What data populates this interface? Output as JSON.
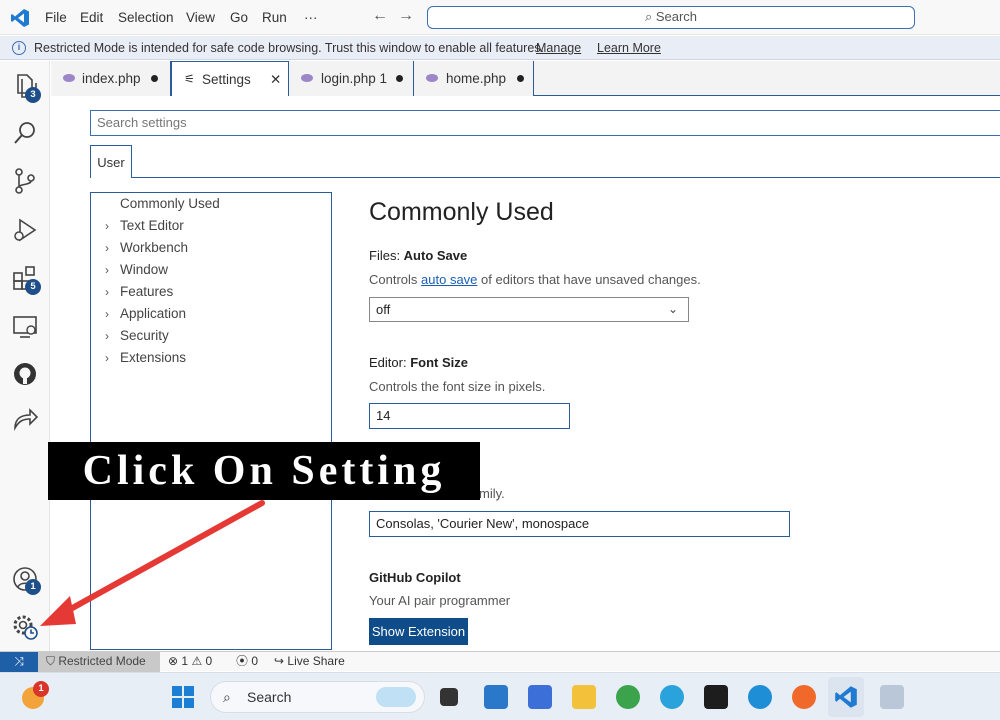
{
  "titlebar": {
    "menus": [
      "File",
      "Edit",
      "Selection",
      "View",
      "Go",
      "Run",
      "···"
    ],
    "search_label": "Search"
  },
  "banner": {
    "message": "Restricted Mode is intended for safe code browsing. Trust this window to enable all features.",
    "manage": "Manage",
    "learn_more": "Learn More"
  },
  "activity_bar": {
    "explorer_badge": "3",
    "extensions_badge": "5",
    "accounts_badge": "1"
  },
  "tabs": [
    {
      "label": "index.php"
    },
    {
      "label": "Settings"
    },
    {
      "label": "login.php 1"
    },
    {
      "label": "home.php"
    }
  ],
  "settings": {
    "search_placeholder": "Search settings",
    "scope_tab": "User",
    "toc": [
      "Commonly Used",
      "Text Editor",
      "Workbench",
      "Window",
      "Features",
      "Application",
      "Security",
      "Extensions"
    ],
    "heading": "Commonly Used",
    "auto_save": {
      "category": "Files: ",
      "name": "Auto Save",
      "desc_pre": "Controls ",
      "desc_link": "auto save",
      "desc_post": " of editors that have unsaved changes.",
      "value": "off"
    },
    "font_size": {
      "category": "Editor: ",
      "name": "Font Size",
      "desc": "Controls the font size in pixels.",
      "value": "14"
    },
    "font_family": {
      "desc_visible": "mily.",
      "value": "Consolas, 'Courier New', monospace"
    },
    "copilot": {
      "title": "GitHub Copilot",
      "desc": "Your AI pair programmer",
      "button": "Show Extension"
    }
  },
  "statusbar": {
    "restricted": "Restricted Mode",
    "errors": "1",
    "warnings": "0",
    "ports": "0",
    "live_share": "Live Share"
  },
  "taskbar": {
    "search": "Search",
    "weather_badge": "1"
  },
  "overlay": {
    "text": "Click On Setting"
  },
  "colors": {
    "accent": "#2b5c99",
    "button": "#0f4c8a",
    "arrow": "#e53935"
  }
}
